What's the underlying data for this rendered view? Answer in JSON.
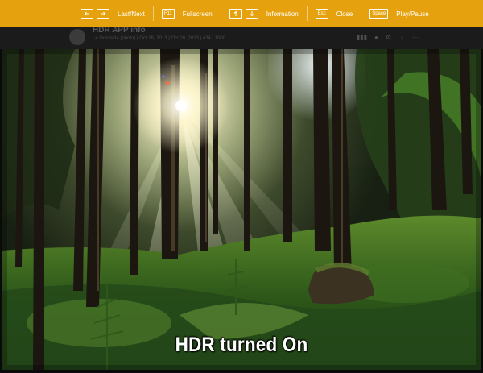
{
  "shortcut_bar": {
    "background": "#e6a20e",
    "items": [
      {
        "keys": [
          "left-arrow-icon",
          "right-arrow-icon"
        ],
        "label": "Last/Next"
      },
      {
        "keys": [
          "F11"
        ],
        "label": "Fullscreen"
      },
      {
        "keys": [
          "up-arrow-icon",
          "down-arrow-icon"
        ],
        "label": "Information"
      },
      {
        "keys": [
          "Esc"
        ],
        "label": "Close"
      },
      {
        "keys": [
          "Space"
        ],
        "label": "Play/Pause"
      }
    ]
  },
  "background_page": {
    "title": "HDR APP info",
    "meta": "Le Grevlada (photo) | Oct 26, 2013 | Oct 26, 2013 | 434 | 1000"
  },
  "photo": {
    "subject": "forest-sunbeam-photo"
  },
  "caption": {
    "text": "HDR turned On"
  }
}
